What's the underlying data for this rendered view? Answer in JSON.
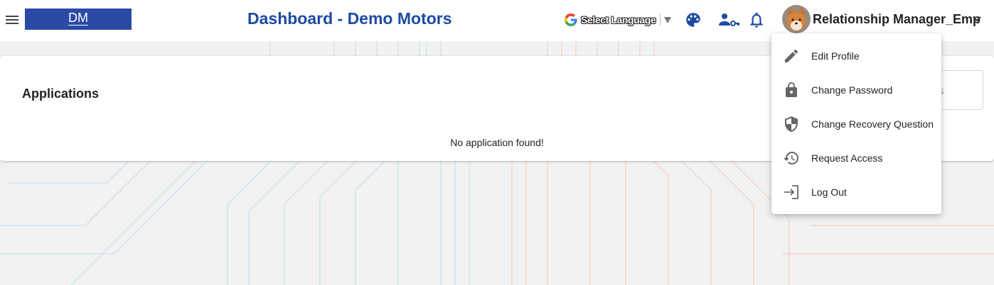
{
  "header": {
    "menu_icon": "hamburger-menu-icon",
    "logo_text": "DM",
    "title": "Dashboard - Demo Motors",
    "language": {
      "icon": "google-g-icon",
      "label": "Select Language"
    },
    "icons": [
      "palette-icon",
      "user-key-icon",
      "bell-icon"
    ],
    "user": {
      "name": "Relationship Manager_Emp",
      "avatar": "shiba-dog-avatar",
      "caret_icon": "chevron-down-icon"
    }
  },
  "card": {
    "title": "Applications",
    "search_placeholder_fragment": "s",
    "empty_message": "No application found!"
  },
  "user_menu": {
    "items": [
      {
        "label": "Edit Profile",
        "icon": "pencil-icon"
      },
      {
        "label": "Change Password",
        "icon": "lock-icon"
      },
      {
        "label": "Change Recovery Question",
        "icon": "shield-icon"
      },
      {
        "label": "Request Access",
        "icon": "history-icon"
      },
      {
        "label": "Log Out",
        "icon": "logout-icon"
      }
    ]
  },
  "colors": {
    "brand_blue": "#1d4aa3",
    "logo_bg": "#2b4aa6",
    "page_bg": "#f2f2f2",
    "icon_gray": "#666666"
  }
}
